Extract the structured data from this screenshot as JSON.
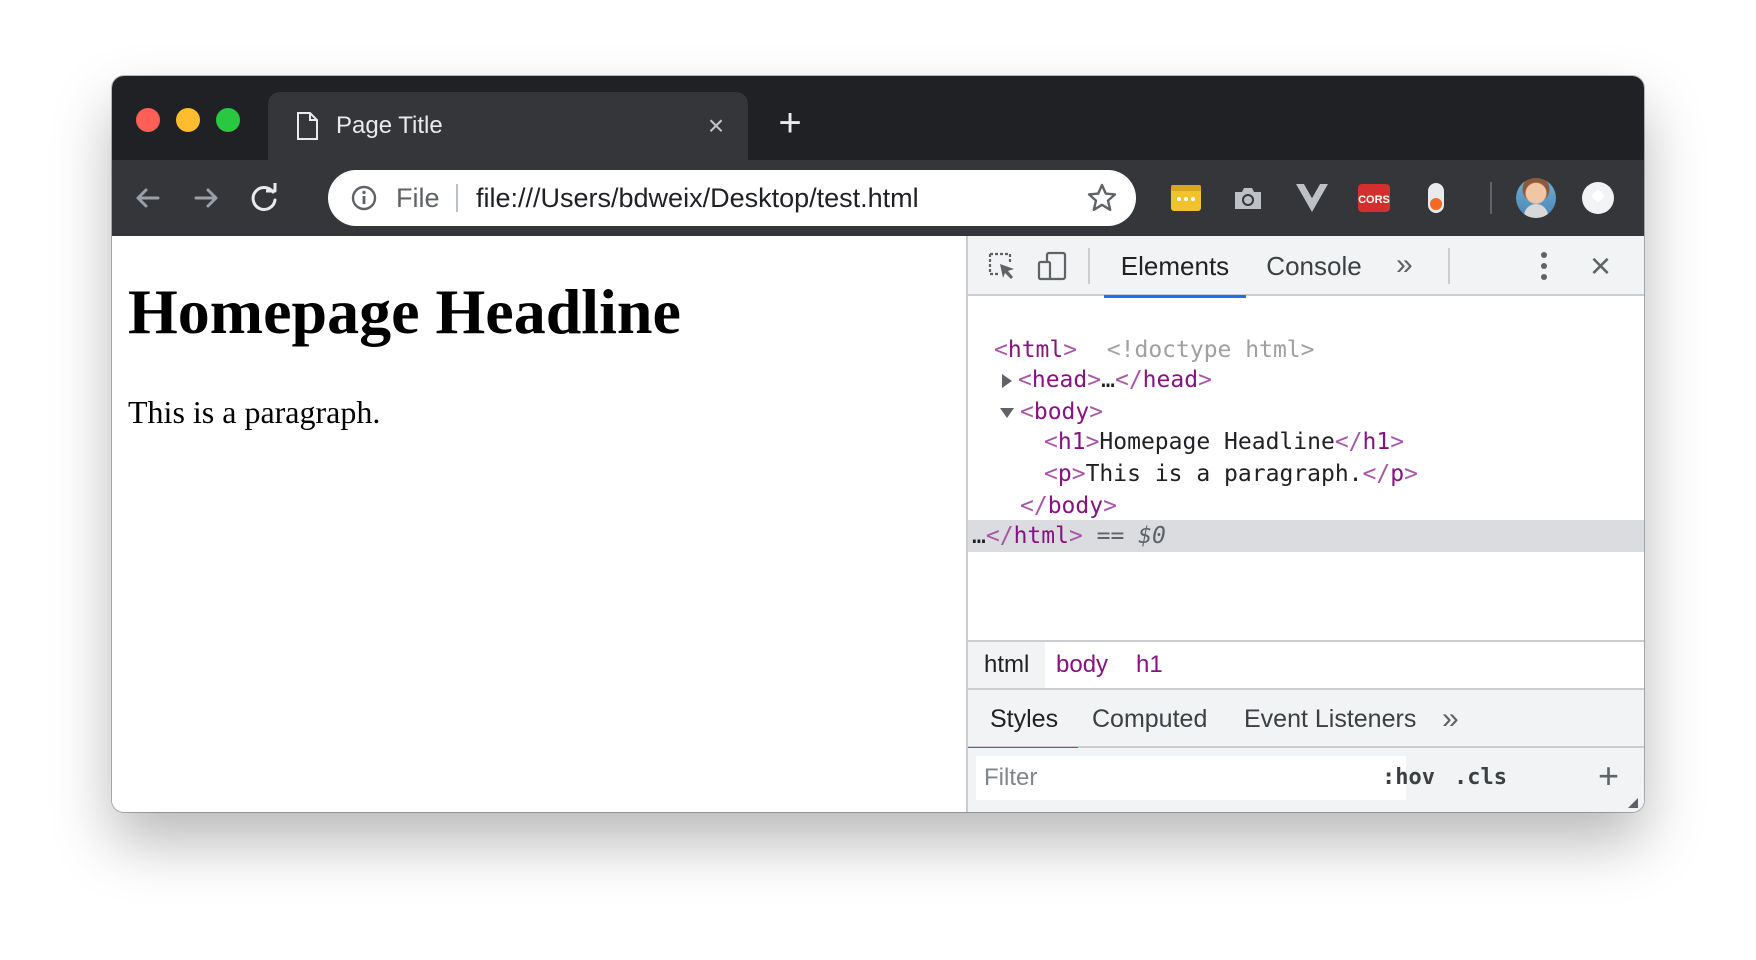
{
  "browser": {
    "tab_title": "Page Title",
    "omnibox": {
      "scheme_label": "File",
      "url": "file:///Users/bdweix/Desktop/test.html"
    },
    "extensions": [
      "notes-extension-icon",
      "camera-extension-icon",
      "vue-devtools-icon",
      "cors-extension-icon",
      "toggle-extension-icon"
    ],
    "extension_labels": {
      "cors": "CORS"
    }
  },
  "page": {
    "headline": "Homepage Headline",
    "paragraph": "This is a paragraph."
  },
  "devtools": {
    "tabs": [
      "Elements",
      "Console"
    ],
    "active_tab": "Elements",
    "dom": {
      "doctype": "<!doctype html>",
      "html_open": "html",
      "head": "head",
      "head_ellipsis": "…",
      "body": "body",
      "h1_tag": "h1",
      "h1_text": "Homepage Headline",
      "p_tag": "p",
      "p_text": "This is a paragraph.",
      "html_close": "html",
      "selected_marker": "== $0",
      "leading_dots": "…"
    },
    "breadcrumbs": [
      "html",
      "body",
      "h1"
    ],
    "styles_tabs": [
      "Styles",
      "Computed",
      "Event Listeners"
    ],
    "filter_placeholder": "Filter",
    "hov_label": ":hov",
    "cls_label": ".cls"
  },
  "colors": {
    "titlebar": "#202124",
    "toolbar": "#35363a",
    "devtools_accent": "#1a73e8",
    "tag_color": "#881280",
    "selected_row": "#dadce0"
  }
}
